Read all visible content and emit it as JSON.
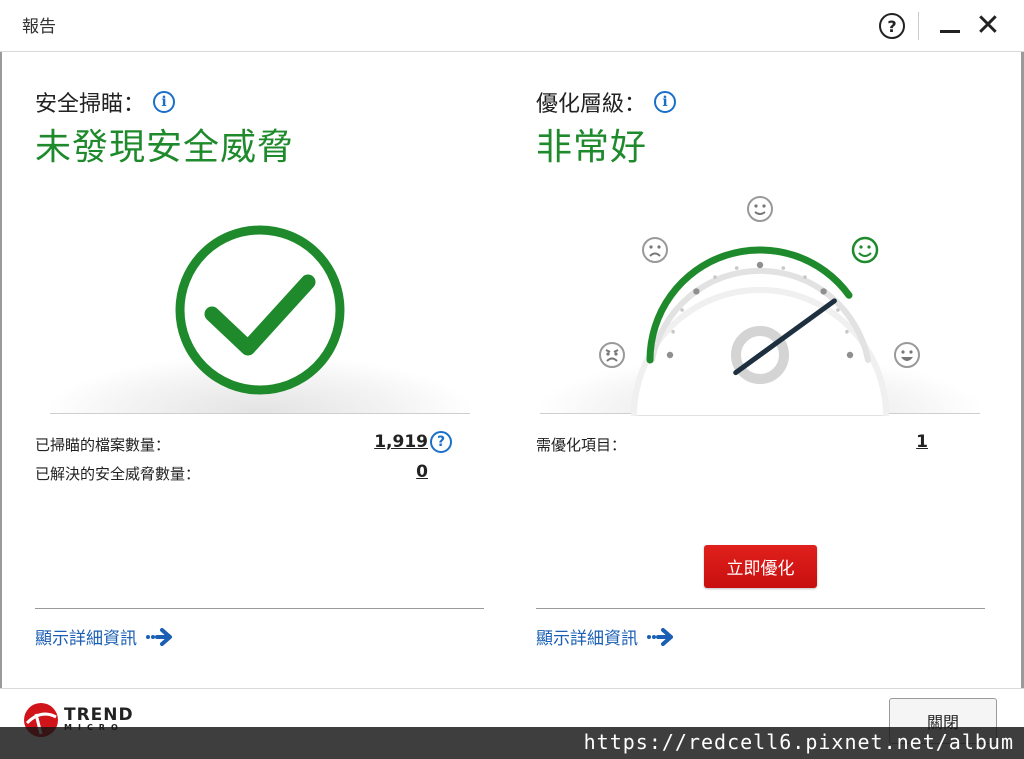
{
  "window": {
    "title": "報告",
    "help_glyph": "?",
    "close_glyph": "✕"
  },
  "security": {
    "label": "安全掃瞄：",
    "status": "未發現安全威脅",
    "scanned_label": "已掃瞄的檔案數量：",
    "scanned_value": "1,919",
    "resolved_label": "已解決的安全威脅數量：",
    "resolved_value": "0",
    "details_link": "顯示詳細資訊",
    "status_color": "#1e8a2c"
  },
  "optimization": {
    "label": "優化層級：",
    "status": "非常好",
    "items_label": "需優化項目：",
    "items_value": "1",
    "optimize_button": "立即優化",
    "details_link": "顯示詳細資訊",
    "gauge_level": 0.8,
    "faces": [
      "angry",
      "sad",
      "neutral",
      "smile",
      "grin"
    ]
  },
  "footer": {
    "brand": "TREND",
    "brand_sub": "MICRO",
    "close_button": "關閉",
    "watermark": "https://redcell6.pixnet.net/album"
  },
  "colors": {
    "accent_green": "#1e8a2c",
    "link_blue": "#1a5fb4",
    "button_red": "#d0141a"
  }
}
